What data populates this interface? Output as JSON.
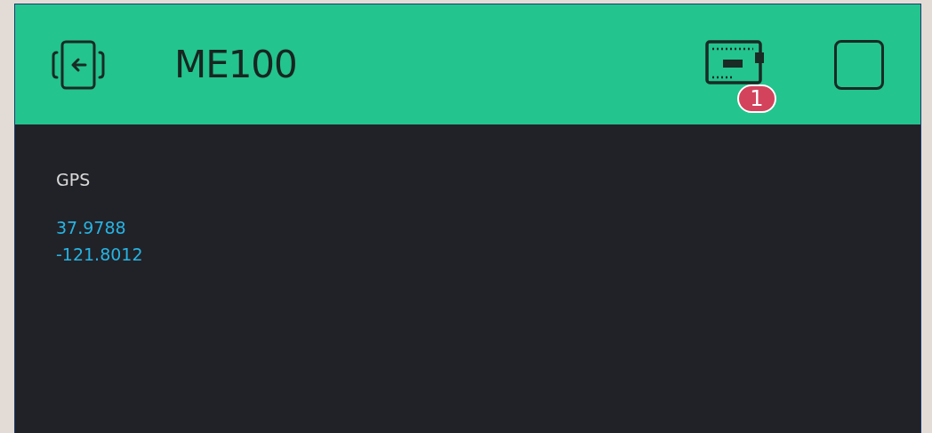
{
  "header": {
    "title": "ME100",
    "device_badge": "1"
  },
  "widget": {
    "label": "GPS",
    "values": [
      "37.9788",
      "-121.8012"
    ]
  }
}
